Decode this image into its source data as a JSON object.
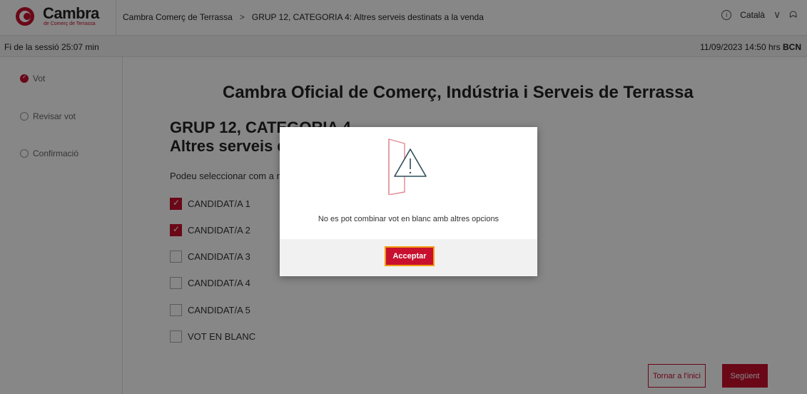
{
  "header": {
    "logo_name": "Cambra",
    "logo_sub": "de Comerç de Terrassa",
    "breadcrumb": [
      "Cambra Comerç de Terrassa",
      "GRUP 12, CATEGORIA 4: Altres serveis destinats a la venda"
    ],
    "breadcrumb_sep": ">",
    "language": "Català",
    "icons": [
      "info-icon",
      "chevron-down-icon",
      "user-icon"
    ]
  },
  "session": {
    "label": "Fi de la sessió",
    "remaining": "25:07 min",
    "datetime": "11/09/2023 14:50 hrs",
    "timezone": "BCN"
  },
  "steps": [
    {
      "label": "Vot",
      "active": true
    },
    {
      "label": "Revisar vot",
      "active": false
    },
    {
      "label": "Confirmació",
      "active": false
    }
  ],
  "main": {
    "org_title": "Cambra Oficial de Comerç, Indústria i Serveis de Terrassa",
    "group_line1": "GRUP 12, CATEGORIA 4",
    "group_line2": "Altres serveis destinats a la venda",
    "instructions": "Podeu seleccionar com a màxim 2 opcions",
    "options": [
      {
        "label": "CANDIDAT/A 1",
        "checked": true
      },
      {
        "label": "CANDIDAT/A 2",
        "checked": true
      },
      {
        "label": "CANDIDAT/A 3",
        "checked": false
      },
      {
        "label": "CANDIDAT/A 4",
        "checked": false
      },
      {
        "label": "CANDIDAT/A 5",
        "checked": false
      },
      {
        "label": "VOT EN BLANC",
        "checked": false
      }
    ],
    "back_button": "Tornar a l'inici",
    "next_button": "Següent"
  },
  "modal": {
    "message": "No es pot combinar vot en blanc amb altres opcions",
    "accept_button": "Acceptar",
    "icon": "warning-icon"
  },
  "colors": {
    "accent": "#c8102e",
    "focus_ring": "#f39c12"
  }
}
